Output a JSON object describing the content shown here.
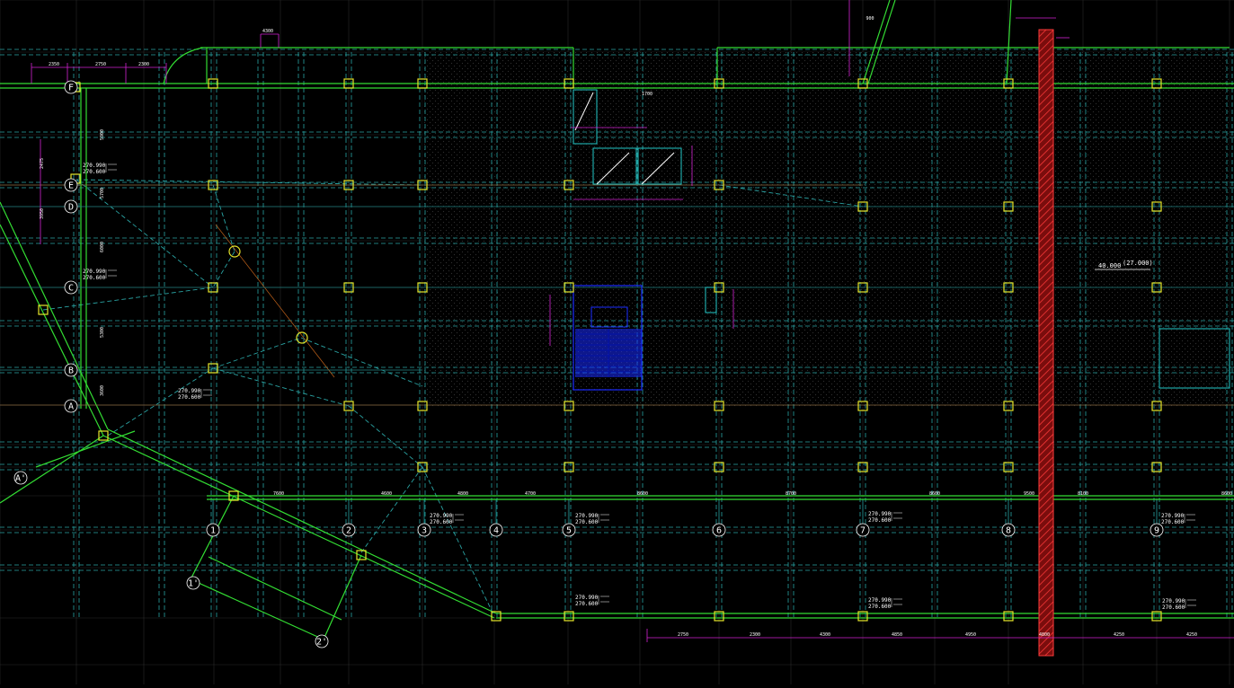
{
  "colors": {
    "background": "#000000",
    "grid": "#3c3c3c",
    "axis": "#22c7c7",
    "structure": "#33dd33",
    "beam": "#2aa3a3",
    "column": "#e6e62a",
    "dimension": "#d222d2",
    "stair": "#1a2bff",
    "highlight": "#ff2a2a",
    "hatch": "#3a3a3a",
    "text": "#ffffff"
  },
  "axes_numbers": [
    "1",
    "2",
    "3",
    "4",
    "5",
    "6",
    "7",
    "8",
    "9"
  ],
  "axes_letters": [
    "F",
    "E",
    "D",
    "C",
    "B",
    "A"
  ],
  "aux_axes": [
    "A'",
    "1'",
    "2'"
  ],
  "elevation_mark": {
    "value": "40.000",
    "bracket": "(27.000)"
  },
  "level_tag": {
    "top": "270.990",
    "bottom": "270.600"
  },
  "bottom_dims": [
    "7600",
    "4600",
    "4800",
    "4700",
    "8600",
    "8700",
    "8600",
    "9500",
    "8100",
    "8600"
  ],
  "lower_dims": [
    "2750",
    "2300",
    "4300",
    "4850",
    "4950",
    "4800",
    "4250",
    "4250"
  ],
  "top_dims": [
    "2350",
    "2750",
    "2300",
    "4300",
    "1700",
    "900"
  ],
  "left_dims": [
    "5900",
    "5700",
    "6000",
    "5300",
    "3600",
    "2475",
    "3950"
  ]
}
